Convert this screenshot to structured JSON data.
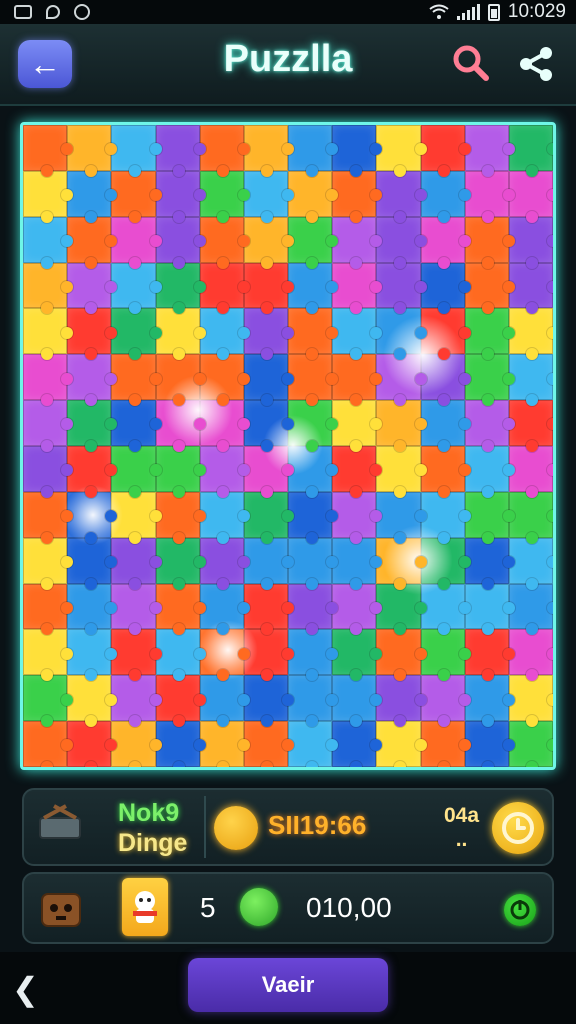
{
  "status_bar": {
    "time": "10:029",
    "icons": [
      "gallery-icon",
      "location-icon",
      "sync-icon",
      "wifi-icon",
      "signal-icon",
      "battery-icon"
    ]
  },
  "header": {
    "title": "Puzzlla",
    "back_icon": "arrow-left-icon",
    "search_icon": "search-icon",
    "share_icon": "share-icon"
  },
  "board": {
    "rows": 14,
    "cols": 12,
    "palette": [
      "#2f9ae8",
      "#3fb8f0",
      "#8a4fe0",
      "#b45ce8",
      "#ff3b30",
      "#ff6a20",
      "#ffb52a",
      "#ffe03a",
      "#3ad04a",
      "#22b866",
      "#1e64d8",
      "#e84dd0"
    ]
  },
  "stats": {
    "level_line1": "Nok9",
    "level_line2": "Dinge",
    "timer": "SII19:66",
    "count": "04a",
    "count_sub": "..",
    "level_icon": "cart-icon",
    "timer_icon": "smiley-icon",
    "clock_icon": "clock-icon"
  },
  "inventory": {
    "pieces_count": "5",
    "score": "010,00",
    "chest_icon": "treasure-chest-icon",
    "card_icon": "character-card-icon",
    "gem_icon": "green-gem-icon",
    "go_icon": "power-icon"
  },
  "bottom_nav": {
    "back_icon": "chevron-left-icon",
    "main_button": "Vaeir"
  }
}
